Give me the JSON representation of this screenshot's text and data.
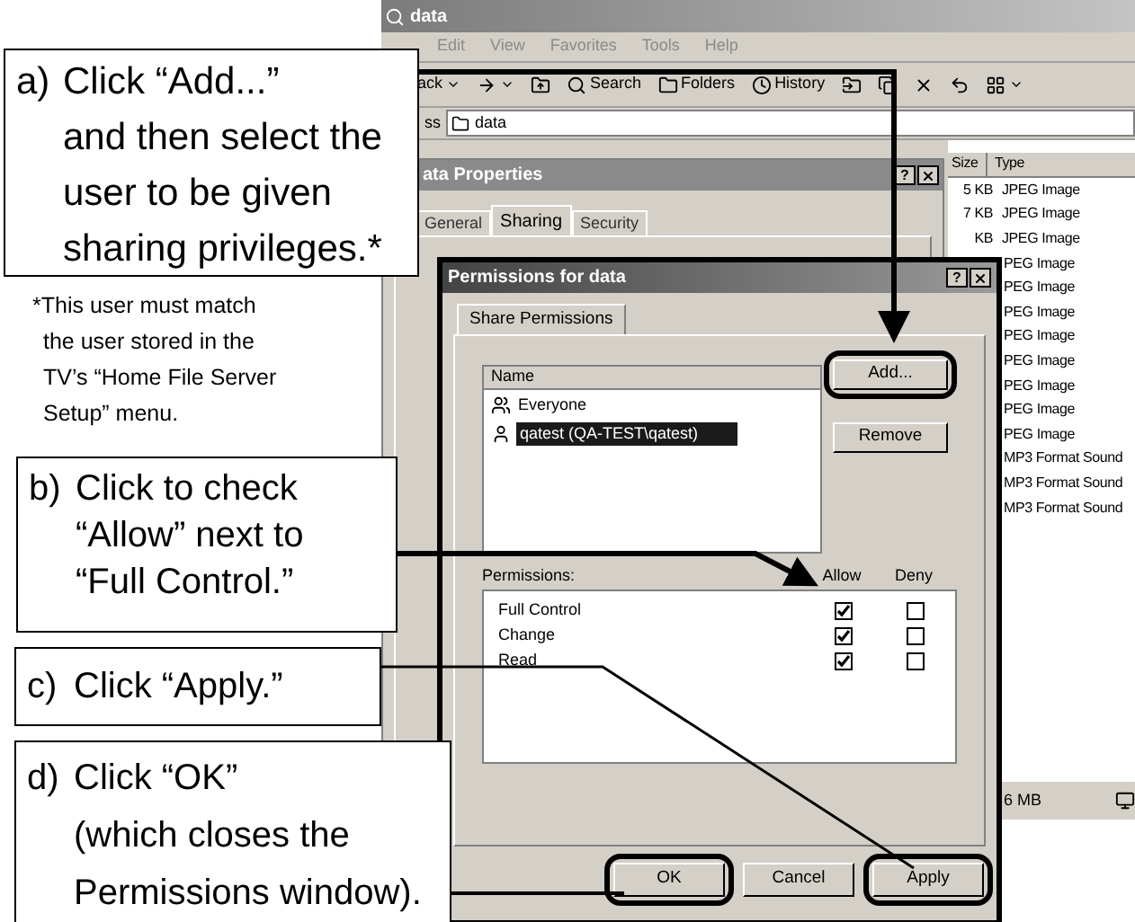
{
  "explorer": {
    "title": "data",
    "menu": [
      "Edit",
      "View",
      "Favorites",
      "Tools",
      "Help"
    ],
    "toolbar": [
      {
        "kind": "back",
        "label": "ack"
      },
      {
        "kind": "forward"
      },
      {
        "kind": "up"
      },
      {
        "kind": "search",
        "label": "Search"
      },
      {
        "kind": "folders",
        "label": "Folders"
      },
      {
        "kind": "history",
        "label": "History"
      },
      {
        "kind": "move"
      },
      {
        "kind": "copy"
      },
      {
        "kind": "delete"
      },
      {
        "kind": "undo"
      },
      {
        "kind": "views"
      }
    ],
    "address": {
      "label": "ss",
      "value": "data"
    },
    "columns": [
      "Size",
      "Type"
    ],
    "files": [
      {
        "size": "5 KB",
        "type": "JPEG Image"
      },
      {
        "size": "7 KB",
        "type": "JPEG Image"
      },
      {
        "size": "KB",
        "type": "JPEG Image"
      },
      {
        "type": "PEG Image"
      },
      {
        "type": "PEG Image"
      },
      {
        "type": "PEG Image"
      },
      {
        "type": "PEG Image"
      },
      {
        "type": "PEG Image"
      },
      {
        "type": "PEG Image"
      },
      {
        "type": "PEG Image"
      },
      {
        "type": "PEG Image"
      },
      {
        "type": "MP3 Format Sound"
      },
      {
        "type": "MP3 Format Sound"
      },
      {
        "type": "MP3 Format Sound"
      }
    ],
    "status": "6 MB"
  },
  "properties": {
    "title": "ata Properties",
    "help_button": "?",
    "tabs": [
      {
        "label": "General",
        "selected": false
      },
      {
        "label": "Sharing",
        "selected": true
      },
      {
        "label": "Security",
        "selected": false
      }
    ]
  },
  "permissions": {
    "title": "Permissions for data",
    "help_button": "?",
    "tab": "Share Permissions",
    "name_header": "Name",
    "users": [
      {
        "name": "Everyone",
        "kind": "group",
        "selected": false
      },
      {
        "name": "qatest (QA-TEST\\qatest)",
        "kind": "user",
        "selected": true
      }
    ],
    "side_buttons": [
      {
        "label": "Add...",
        "circled": true
      },
      {
        "label": "Remove",
        "circled": false
      }
    ],
    "permissions_label": "Permissions:",
    "columns": [
      "Allow",
      "Deny"
    ],
    "rows": [
      {
        "name": "Full Control",
        "allow": true,
        "deny": false
      },
      {
        "name": "Change",
        "allow": true,
        "deny": false
      },
      {
        "name": "Read",
        "allow": true,
        "deny": false
      }
    ],
    "buttons": [
      {
        "label": "OK",
        "circled": true
      },
      {
        "label": "Cancel",
        "circled": false
      },
      {
        "label": "Apply",
        "circled": true
      }
    ]
  },
  "callouts": [
    {
      "letter": "a)",
      "lines": [
        "Click “Add...”",
        "and then select the",
        "user to be given",
        "sharing privileges.*"
      ]
    },
    {
      "letter": "b)",
      "lines": [
        "Click to check",
        "“Allow” next to",
        "“Full Control.”"
      ]
    },
    {
      "letter": "c)",
      "lines": [
        "Click “Apply.”"
      ]
    },
    {
      "letter": "d)",
      "lines": [
        "Click “OK”",
        "(which closes the",
        "Permissions window)."
      ]
    }
  ],
  "footnote": [
    "*This user must match",
    "the user stored in the",
    "TV’s “Home File Server",
    "Setup” menu."
  ]
}
